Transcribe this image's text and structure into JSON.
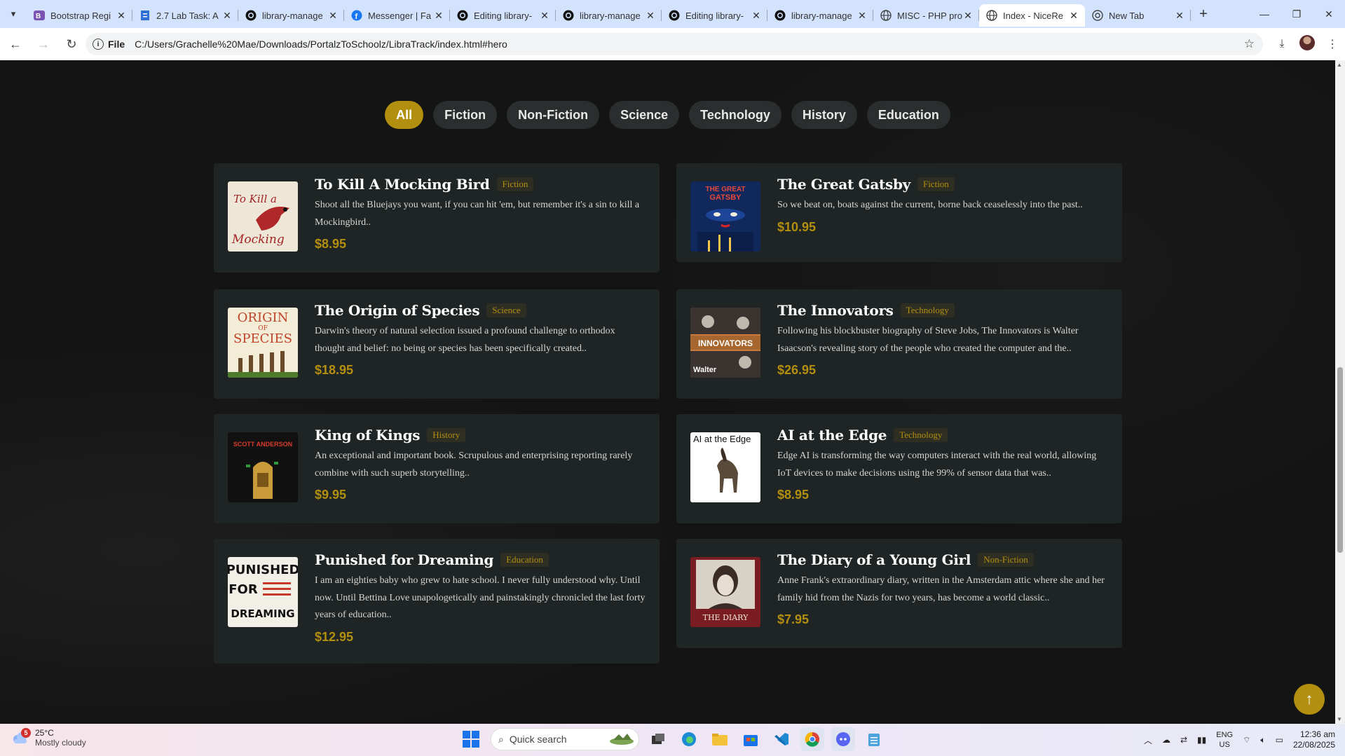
{
  "browser": {
    "tabs": [
      {
        "title": "Bootstrap Regi",
        "icon": "bootstrap-icon"
      },
      {
        "title": "2.7 Lab Task: A",
        "icon": "document-icon"
      },
      {
        "title": "library-manage",
        "icon": "github-icon"
      },
      {
        "title": "Messenger | Fa",
        "icon": "facebook-icon"
      },
      {
        "title": "Editing library-",
        "icon": "github-icon"
      },
      {
        "title": "library-manage",
        "icon": "github-icon"
      },
      {
        "title": "Editing library-",
        "icon": "github-icon"
      },
      {
        "title": "library-manage",
        "icon": "github-icon"
      },
      {
        "title": "MISC - PHP pro",
        "icon": "globe-icon"
      },
      {
        "title": "Index - NiceRe",
        "icon": "globe-icon",
        "active": true
      },
      {
        "title": "New Tab",
        "icon": "chrome-icon"
      }
    ],
    "address": {
      "scheme": "File",
      "url": "C:/Users/Grachelle%20Mae/Downloads/PortalzToSchoolz/LibraTrack/index.html#hero"
    }
  },
  "page": {
    "accent": "#b38f0f",
    "filters": [
      "All",
      "Fiction",
      "Non-Fiction",
      "Science",
      "Technology",
      "History",
      "Education"
    ],
    "active_filter": "All",
    "books": [
      {
        "title": "To Kill A Mocking Bird",
        "category": "Fiction",
        "description": "Shoot all the Bluejays you want, if you can hit 'em, but remember it's a sin to kill a Mockingbird..",
        "price": "$8.95",
        "cover": "mockingbird-cover"
      },
      {
        "title": "The Great Gatsby",
        "category": "Fiction",
        "description": "So we beat on, boats against the current, borne back ceaselessly into the past..",
        "price": "$10.95",
        "cover": "gatsby-cover"
      },
      {
        "title": "The Origin of Species",
        "category": "Science",
        "description": "Darwin's theory of natural selection issued a profound challenge to orthodox thought and belief: no being or species has been specifically created..",
        "price": "$18.95",
        "cover": "origin-cover"
      },
      {
        "title": "The Innovators",
        "category": "Technology",
        "description": "Following his blockbuster biography of Steve Jobs, The Innovators is Walter Isaacson's revealing story of the people who created the computer and the..",
        "price": "$26.95",
        "cover": "innovators-cover"
      },
      {
        "title": "King of Kings",
        "category": "History",
        "description": "An exceptional and important book. Scrupulous and enterprising reporting rarely combine with such superb storytelling..",
        "price": "$9.95",
        "cover": "kings-cover"
      },
      {
        "title": "AI at the Edge",
        "category": "Technology",
        "description": "Edge AI is transforming the way computers interact with the real world, allowing IoT devices to make decisions using the 99% of sensor data that was..",
        "price": "$8.95",
        "cover": "ai-edge-cover"
      },
      {
        "title": "Punished for Dreaming",
        "category": "Education",
        "description": "I am an eighties baby who grew to hate school. I never fully understood why. Until now. Until Bettina Love unapologetically and painstakingly chronicled the last forty years of education..",
        "price": "$12.95",
        "cover": "punished-cover"
      },
      {
        "title": "The Diary of a Young Girl",
        "category": "Non-Fiction",
        "description": "Anne Frank's extraordinary diary, written in the Amsterdam attic where she and her family hid from the Nazis for two years, has become a world classic..",
        "price": "$7.95",
        "cover": "diary-cover"
      }
    ],
    "cover_text": {
      "mockingbird": [
        "To Kill a",
        "Mocking"
      ],
      "gatsby": [
        "THE GREAT",
        "GATSBY"
      ],
      "origin": [
        "ORIGIN",
        "OF",
        "SPECIES"
      ],
      "innovators": [
        "INNOVATORS",
        "Walter"
      ],
      "kings": [
        "SCOTT ANDERSON"
      ],
      "ai_edge": "AI at the Edge",
      "punished": [
        "PUNISHED",
        "FOR",
        "DREAMING"
      ],
      "diary": "THE DIARY"
    }
  },
  "taskbar": {
    "weather_badge": "5",
    "temperature": "25°C",
    "condition": "Mostly cloudy",
    "search_placeholder": "Quick search",
    "lang_1": "ENG",
    "lang_2": "US",
    "time": "12:36 am",
    "date": "22/08/2025"
  }
}
